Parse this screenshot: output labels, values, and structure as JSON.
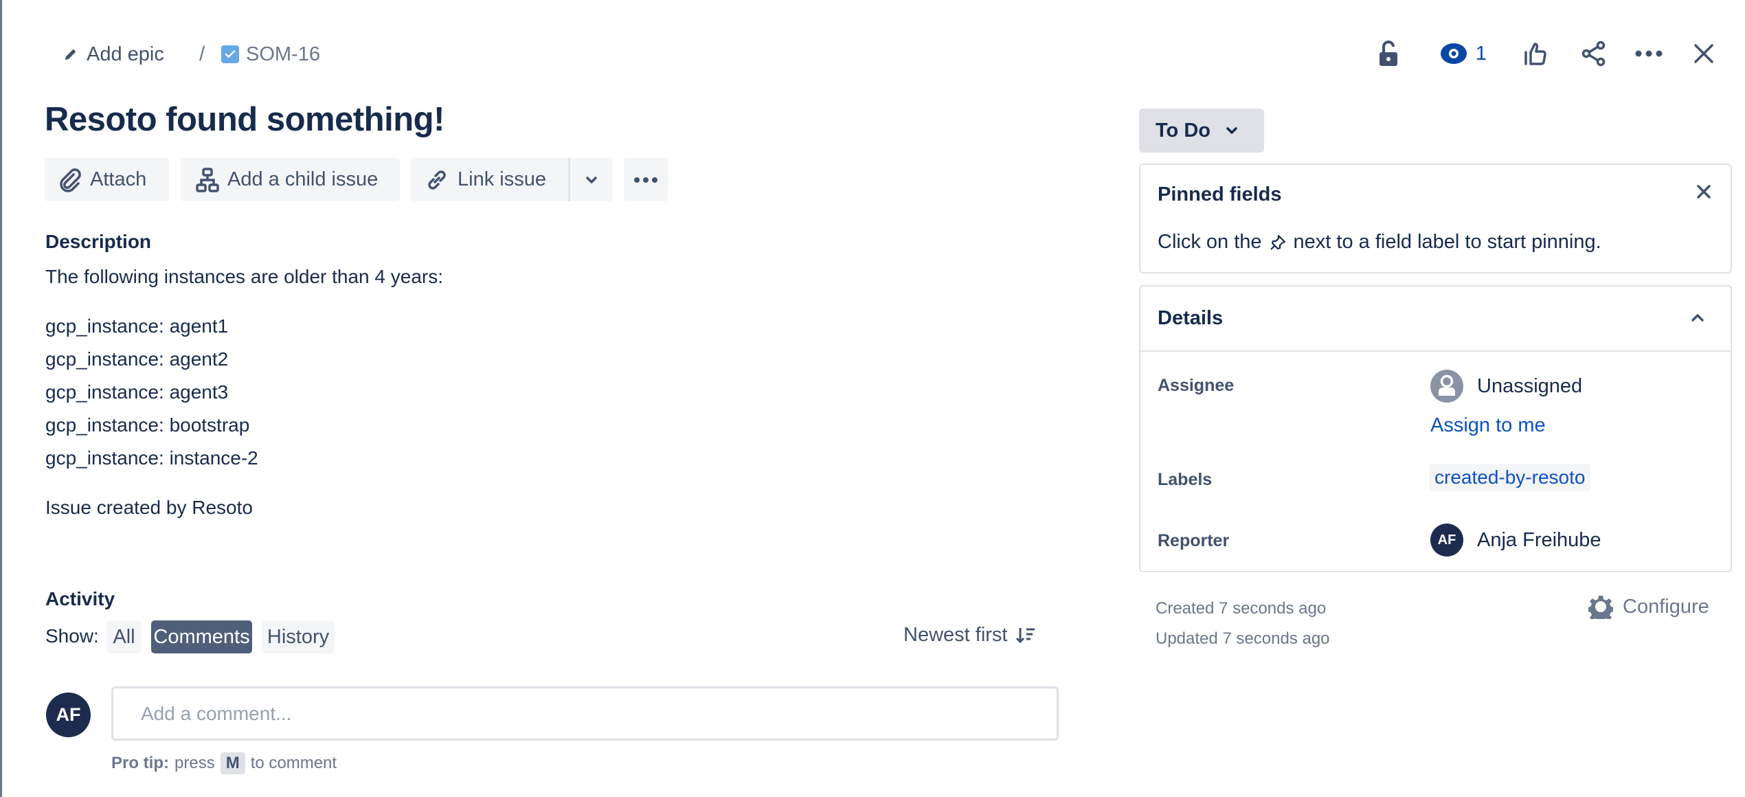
{
  "breadcrumb": {
    "epic_label": "Add epic",
    "separator": "/",
    "issue_key": "SOM-16"
  },
  "header_actions": {
    "lock_icon": "unlock-icon",
    "watch_icon": "eye-icon",
    "watch_count": "1",
    "like_icon": "thumbs-up-icon",
    "share_icon": "share-icon",
    "more_icon": "more-icon",
    "close_icon": "close-icon"
  },
  "issue": {
    "title": "Resoto found something!"
  },
  "actions": {
    "attach": "Attach",
    "add_child": "Add a child issue",
    "link_issue": "Link issue"
  },
  "description": {
    "heading": "Description",
    "intro": "The following instances are older than 4 years:",
    "items": [
      "gcp_instance: agent1",
      "gcp_instance: agent2",
      "gcp_instance: agent3",
      "gcp_instance: bootstrap",
      "gcp_instance: instance-2"
    ],
    "footer": "Issue created by Resoto"
  },
  "activity": {
    "heading": "Activity",
    "show_label": "Show:",
    "filters": [
      {
        "label": "All",
        "active": false
      },
      {
        "label": "Comments",
        "active": true
      },
      {
        "label": "History",
        "active": false
      }
    ],
    "sort_label": "Newest first",
    "comment": {
      "avatar_initials": "AF",
      "placeholder": "Add a comment..."
    },
    "protip": {
      "prefix": "Pro tip:",
      "press": "press",
      "key": "M",
      "suffix": "to comment"
    }
  },
  "sidebar": {
    "status": "To Do",
    "pinned": {
      "title": "Pinned fields",
      "hint_before": "Click on the",
      "hint_after": "next to a field label to start pinning."
    },
    "details": {
      "title": "Details",
      "assignee_label": "Assignee",
      "assignee_value": "Unassigned",
      "assign_to_me": "Assign to me",
      "labels_label": "Labels",
      "labels": [
        "created-by-resoto"
      ],
      "reporter_label": "Reporter",
      "reporter_initials": "AF",
      "reporter_name": "Anja Freihube"
    },
    "created": "Created 7 seconds ago",
    "updated": "Updated 7 seconds ago",
    "configure": "Configure"
  },
  "colors": {
    "text_primary": "#172b4d",
    "text_secondary": "#42526e",
    "link": "#0c51c4",
    "watch_active": "#0747a6",
    "task_icon": "#65a9e6",
    "selected_chip": "#505f79",
    "avatar_bg": "#1d2b4e"
  }
}
